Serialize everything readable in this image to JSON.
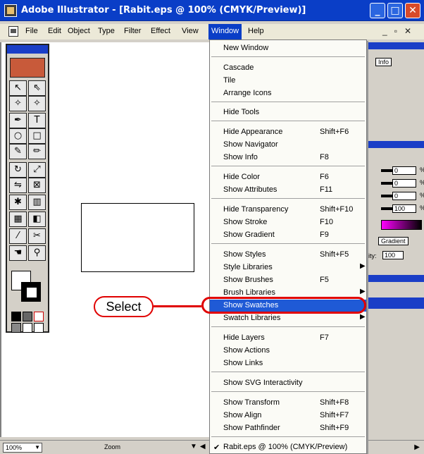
{
  "window": {
    "title": "Adobe Illustrator - [Rabit.eps @ 100% (CMYK/Preview)]"
  },
  "menubar": {
    "items": [
      "File",
      "Edit",
      "Object",
      "Type",
      "Filter",
      "Effect",
      "View",
      "Window",
      "Help"
    ],
    "active": "Window"
  },
  "window_menu": {
    "items": [
      {
        "label": "New Window",
        "shortcut": ""
      },
      {
        "label": "Cascade",
        "shortcut": ""
      },
      {
        "label": "Tile",
        "shortcut": ""
      },
      {
        "label": "Arrange Icons",
        "shortcut": ""
      },
      {
        "label": "Hide Tools",
        "shortcut": ""
      },
      {
        "label": "Hide Appearance",
        "shortcut": "Shift+F6"
      },
      {
        "label": "Show Navigator",
        "shortcut": ""
      },
      {
        "label": "Show Info",
        "shortcut": "F8"
      },
      {
        "label": "Hide Color",
        "shortcut": "F6"
      },
      {
        "label": "Show Attributes",
        "shortcut": "F11"
      },
      {
        "label": "Hide Transparency",
        "shortcut": "Shift+F10"
      },
      {
        "label": "Show Stroke",
        "shortcut": "F10"
      },
      {
        "label": "Show Gradient",
        "shortcut": "F9"
      },
      {
        "label": "Show Styles",
        "shortcut": "Shift+F5"
      },
      {
        "label": "Style Libraries",
        "shortcut": ""
      },
      {
        "label": "Show Brushes",
        "shortcut": "F5"
      },
      {
        "label": "Brush Libraries",
        "shortcut": ""
      },
      {
        "label": "Show Swatches",
        "shortcut": ""
      },
      {
        "label": "Swatch Libraries",
        "shortcut": ""
      },
      {
        "label": "Hide Layers",
        "shortcut": "F7"
      },
      {
        "label": "Show Actions",
        "shortcut": ""
      },
      {
        "label": "Show Links",
        "shortcut": ""
      },
      {
        "label": "Show SVG Interactivity",
        "shortcut": ""
      },
      {
        "label": "Show Transform",
        "shortcut": "Shift+F8"
      },
      {
        "label": "Show Align",
        "shortcut": "Shift+F7"
      },
      {
        "label": "Show Pathfinder",
        "shortcut": "Shift+F9"
      },
      {
        "label": "Rabit.eps @ 100% (CMYK/Preview)",
        "shortcut": ""
      }
    ],
    "highlighted": "Show Swatches"
  },
  "callout": {
    "text": "Select"
  },
  "panels": {
    "info_tab": "Info",
    "gradient_tab": "Gradient",
    "opacity_label": "ity:",
    "opacity_value": "100",
    "color_values": [
      "0",
      "0",
      "0",
      "100"
    ],
    "percent": "%"
  },
  "statusbar": {
    "zoom_value": "100%",
    "tool_label": "Zoom"
  }
}
